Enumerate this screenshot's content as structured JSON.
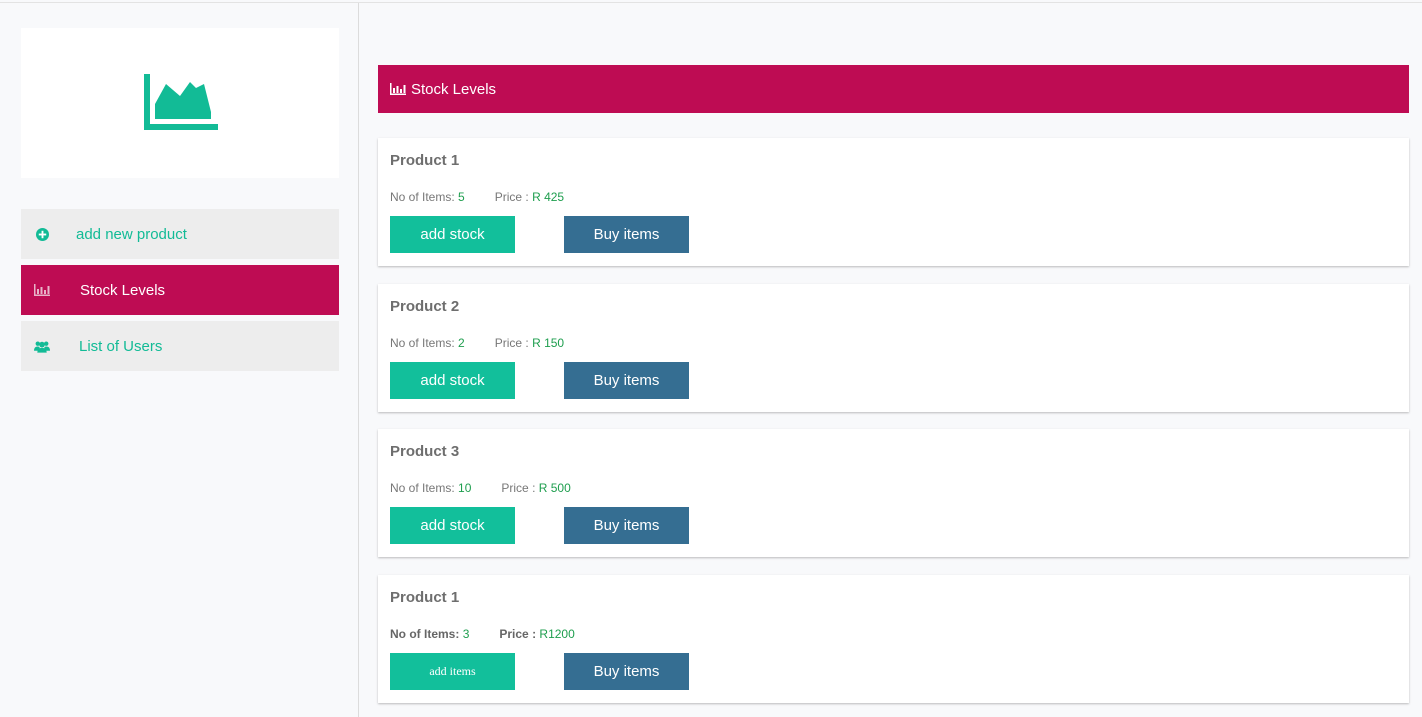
{
  "colors": {
    "accent_pink": "#be0c53",
    "accent_green": "#12bf9b",
    "accent_blue": "#356e92",
    "value_green": "#1e9e4e"
  },
  "sidebar": {
    "logo_icon": "area-chart-icon",
    "items": [
      {
        "label": "add new product",
        "icon": "plus-circle-icon",
        "active": false
      },
      {
        "label": "Stock Levels",
        "icon": "bar-chart-icon",
        "active": true
      },
      {
        "label": "List of Users",
        "icon": "users-icon",
        "active": false
      }
    ]
  },
  "header": {
    "title": "Stock Levels",
    "icon": "bar-chart-icon"
  },
  "products": [
    {
      "name": "Product 1",
      "items_label": "No of Items:",
      "items": "5",
      "price_label": "Price :",
      "price": "R 425",
      "primary_button": "add stock",
      "secondary_button": "Buy items"
    },
    {
      "name": "Product 2",
      "items_label": "No of Items:",
      "items": "2",
      "price_label": "Price :",
      "price": "R 150",
      "primary_button": "add stock",
      "secondary_button": "Buy items"
    },
    {
      "name": "Product 3",
      "items_label": "No of Items:",
      "items": "10",
      "price_label": "Price :",
      "price": "R 500",
      "primary_button": "add stock",
      "secondary_button": "Buy items"
    },
    {
      "name": "Product 1",
      "items_label": "No of Items:",
      "items": "3",
      "price_label": "Price :",
      "price": "R1200",
      "primary_button": "add items",
      "secondary_button": "Buy items"
    }
  ]
}
